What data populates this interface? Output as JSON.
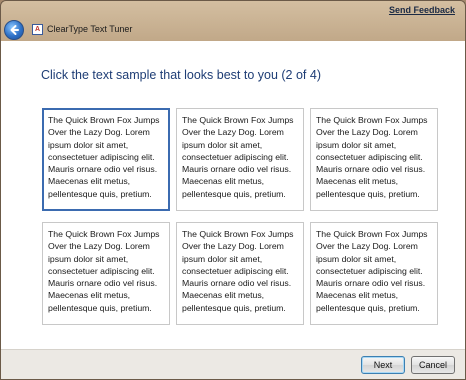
{
  "window": {
    "app_title": "ClearType Text Tuner",
    "feedback_link": "Send Feedback",
    "app_icon_glyph": "A"
  },
  "main": {
    "heading": "Click the text sample that looks best to you (2 of 4)",
    "selected_index": 0,
    "samples": [
      {
        "text": "The Quick Brown Fox Jumps Over the Lazy Dog. Lorem ipsum dolor sit amet, consectetuer adipiscing elit. Mauris ornare odio vel risus. Maecenas elit metus, pellentesque quis, pretium."
      },
      {
        "text": "The Quick Brown Fox Jumps Over the Lazy Dog. Lorem ipsum dolor sit amet, consectetuer adipiscing elit. Mauris ornare odio vel risus. Maecenas elit metus, pellentesque quis, pretium."
      },
      {
        "text": "The Quick Brown Fox Jumps Over the Lazy Dog. Lorem ipsum dolor sit amet, consectetuer adipiscing elit. Mauris ornare odio vel risus. Maecenas elit metus, pellentesque quis, pretium."
      },
      {
        "text": "The Quick Brown Fox Jumps Over the Lazy Dog. Lorem ipsum dolor sit amet, consectetuer adipiscing elit. Mauris ornare odio vel risus. Maecenas elit metus, pellentesque quis, pretium."
      },
      {
        "text": "The Quick Brown Fox Jumps Over the Lazy Dog. Lorem ipsum dolor sit amet, consectetuer adipiscing elit. Mauris ornare odio vel risus. Maecenas elit metus, pellentesque quis, pretium."
      },
      {
        "text": "The Quick Brown Fox Jumps Over the Lazy Dog. Lorem ipsum dolor sit amet, consectetuer adipiscing elit. Mauris ornare odio vel risus. Maecenas elit metus, pellentesque quis, pretium."
      }
    ]
  },
  "footer": {
    "next_label": "Next",
    "cancel_label": "Cancel"
  },
  "colors": {
    "heading": "#1e3d75",
    "selection_border": "#3b6bb0",
    "link": "#1b2a44"
  },
  "icons": {
    "back": "back-arrow-icon",
    "app": "cleartype-app-icon"
  }
}
